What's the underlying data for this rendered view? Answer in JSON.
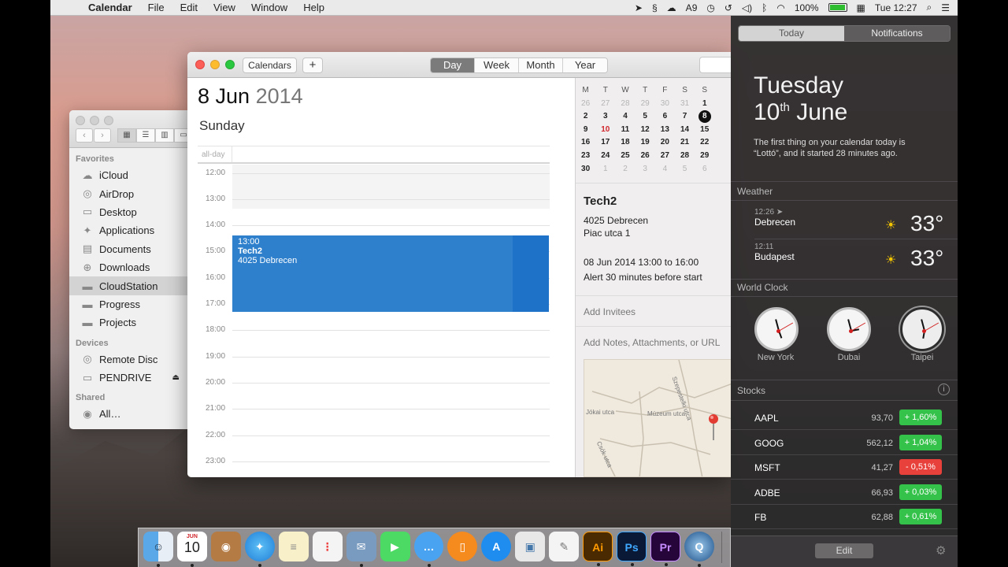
{
  "menubar": {
    "app": "Calendar",
    "items": [
      "File",
      "Edit",
      "View",
      "Window",
      "Help"
    ],
    "wifi_badge": "9",
    "battery": "100%",
    "clock": "Tue 12:27"
  },
  "finder": {
    "favorites_label": "Favorites",
    "favorites": [
      {
        "label": "iCloud",
        "icon": "cloud-icon"
      },
      {
        "label": "AirDrop",
        "icon": "airdrop-icon"
      },
      {
        "label": "Desktop",
        "icon": "desktop-icon"
      },
      {
        "label": "Applications",
        "icon": "applications-icon"
      },
      {
        "label": "Documents",
        "icon": "documents-icon"
      },
      {
        "label": "Downloads",
        "icon": "downloads-icon"
      },
      {
        "label": "CloudStation",
        "icon": "folder-icon"
      },
      {
        "label": "Progress",
        "icon": "folder-icon"
      },
      {
        "label": "Projects",
        "icon": "folder-icon"
      }
    ],
    "devices_label": "Devices",
    "devices": [
      {
        "label": "Remote Disc",
        "icon": "disc-icon"
      },
      {
        "label": "PENDRIVE",
        "icon": "drive-icon"
      }
    ],
    "shared_label": "Shared",
    "shared": [
      {
        "label": "All…",
        "icon": "network-icon"
      }
    ]
  },
  "calendar": {
    "calendars_button": "Calendars",
    "add_button": "+",
    "views": [
      "Day",
      "Week",
      "Month",
      "Year"
    ],
    "active_view": "Day",
    "date_day_month": "8 Jun",
    "date_year": "2014",
    "weekday": "Sunday",
    "allday_label": "all-day",
    "hours": [
      "12:00",
      "13:00",
      "14:00",
      "15:00",
      "16:00",
      "17:00",
      "18:00",
      "19:00",
      "20:00",
      "21:00",
      "22:00",
      "23:00"
    ],
    "event": {
      "time": "13:00",
      "title": "Tech2",
      "location": "4025 Debrecen"
    },
    "mini_headers": [
      "M",
      "T",
      "W",
      "T",
      "F",
      "S",
      "S"
    ],
    "mini_weeks": [
      [
        "26",
        "27",
        "28",
        "29",
        "30",
        "31",
        "1"
      ],
      [
        "2",
        "3",
        "4",
        "5",
        "6",
        "7",
        "8"
      ],
      [
        "9",
        "10",
        "11",
        "12",
        "13",
        "14",
        "15"
      ],
      [
        "16",
        "17",
        "18",
        "19",
        "20",
        "21",
        "22"
      ],
      [
        "23",
        "24",
        "25",
        "26",
        "27",
        "28",
        "29"
      ],
      [
        "30",
        "1",
        "2",
        "3",
        "4",
        "5",
        "6"
      ]
    ],
    "inspector": {
      "title": "Tech2",
      "location_line1": "4025 Debrecen",
      "location_line2": "Piac utca 1",
      "datetime": "08 Jun 2014  13:00 to 16:00",
      "alert": "Alert 30 minutes before start",
      "add_invitees": "Add Invitees",
      "add_notes": "Add Notes, Attachments, or URL",
      "map_streets": [
        "Jókai utca",
        "Múzeum utca",
        "Szepestelki utca",
        "Csók utca"
      ]
    }
  },
  "notification_center": {
    "tabs": [
      "Today",
      "Notifications"
    ],
    "date_line1": "Tuesday",
    "date_line2_num": "10",
    "date_line2_sup": "th",
    "date_line2_month": " June",
    "summary": "The first thing on your calendar today is “Lottó”, and it started 28 minutes ago.",
    "weather_label": "Weather",
    "weather": [
      {
        "time": "12:26",
        "city": "Debrecen",
        "temp": "33°"
      },
      {
        "time": "12:11",
        "city": "Budapest",
        "temp": "33°"
      }
    ],
    "world_clock_label": "World Clock",
    "clocks": [
      "New York",
      "Dubai",
      "Taipei"
    ],
    "stocks_label": "Stocks",
    "stocks": [
      {
        "symbol": "AAPL",
        "price": "93,70",
        "change": "+ 1,60%",
        "direction": "up"
      },
      {
        "symbol": "GOOG",
        "price": "562,12",
        "change": "+ 1,04%",
        "direction": "up"
      },
      {
        "symbol": "MSFT",
        "price": "41,27",
        "change": "- 0,51%",
        "direction": "down"
      },
      {
        "symbol": "ADBE",
        "price": "66,93",
        "change": "+ 0,03%",
        "direction": "up"
      },
      {
        "symbol": "FB",
        "price": "62,88",
        "change": "+ 0,61%",
        "direction": "up"
      }
    ],
    "edit_button": "Edit"
  },
  "dock": {
    "calendar_month": "JUN",
    "calendar_day": "10",
    "ai_label": "Ai",
    "ps_label": "Ps",
    "pr_label": "Pr"
  },
  "colors": {
    "event_blue": "#2f80cc",
    "stock_up": "#35c24a",
    "stock_down": "#e8403a",
    "today_red": "#d0262c"
  }
}
